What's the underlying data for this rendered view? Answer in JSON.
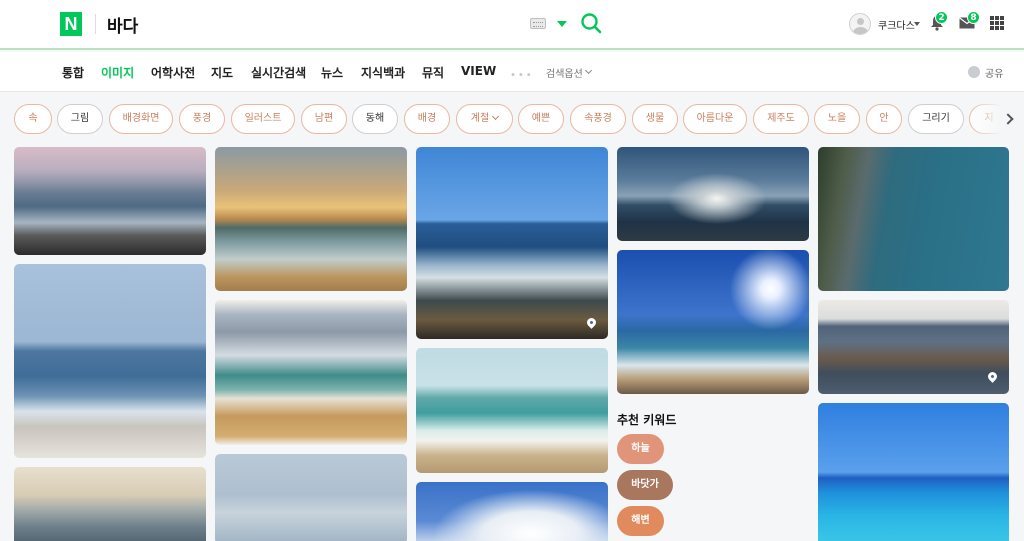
{
  "header": {
    "logo": "N",
    "query": "바다",
    "username": "쿠크다스",
    "notification_count": "2",
    "mail_count": "8"
  },
  "tabs": [
    {
      "label": "통합"
    },
    {
      "label": "이미지",
      "active": true
    },
    {
      "label": "어학사전"
    },
    {
      "label": "지도"
    },
    {
      "label": "실시간검색"
    },
    {
      "label": "뉴스"
    },
    {
      "label": "지식백과"
    },
    {
      "label": "뮤직"
    },
    {
      "label": "VIEW"
    }
  ],
  "tabbar": {
    "more": "•••",
    "search_options": "검색옵션",
    "share": "공유"
  },
  "keyword_chips": [
    "속",
    "그림",
    "배경화면",
    "풍경",
    "일러스트",
    "남편",
    "동해",
    "배경",
    "계절",
    "예쁜",
    "속풍경",
    "생물",
    "아름다운",
    "제주도",
    "노을",
    "안",
    "그리기",
    "지"
  ],
  "recommend": {
    "title": "추천 키워드",
    "keywords": [
      {
        "label": "하늘",
        "color": "#e0957a"
      },
      {
        "label": "바닷가",
        "color": "#a9765e"
      },
      {
        "label": "해변",
        "color": "#e08a5e"
      }
    ]
  },
  "icons": {
    "keyboard": "keyboard-icon",
    "search": "search-icon",
    "bell": "bell-icon",
    "mail": "mail-icon",
    "apps": "apps-grid-icon",
    "pin": "location-pin-icon"
  },
  "colors": {
    "brand": "#03c75a",
    "chip_text": "#c77f5d",
    "chip_border": "#e8b8a1"
  }
}
